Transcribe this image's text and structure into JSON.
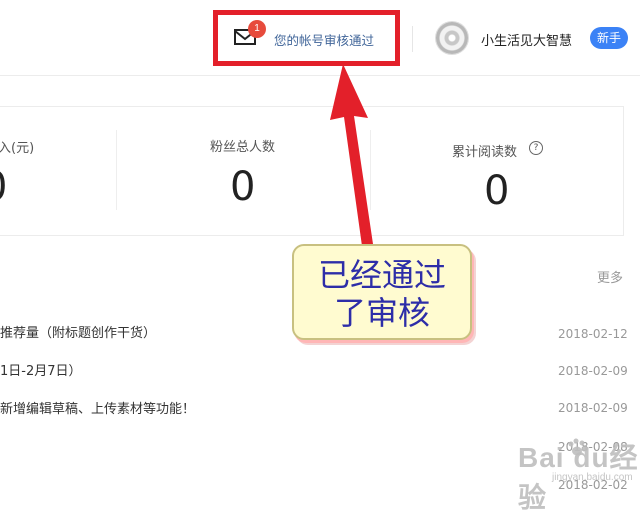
{
  "header": {
    "mail_icon": "envelope-icon",
    "unread_count": "1",
    "notice_text": "您的帐号审核通过",
    "username": "小生活见大智慧",
    "newbie_button": "新手"
  },
  "stats": [
    {
      "label": "入(元)",
      "value": "0"
    },
    {
      "label": "粉丝总人数",
      "value": "0"
    },
    {
      "label": "累计阅读数",
      "value": "0",
      "help_icon": "question-circle-icon"
    }
  ],
  "list": {
    "more_label": "更多",
    "items": [
      {
        "title": "推荐量（附标题创作干货）",
        "date": "2018-02-12"
      },
      {
        "title": "1日-2月7日）",
        "date": "2018-02-09"
      },
      {
        "title": "新增编辑草稿、上传素材等功能！",
        "date": "2018-02-09"
      },
      {
        "title": "",
        "date": "2018-02-08"
      },
      {
        "title": "",
        "date": "2018-02-02"
      }
    ]
  },
  "annotation": {
    "callout_text": "已经通过\n了审核",
    "colors": {
      "highlight_box": "#e3202a",
      "arrow": "#e3202a",
      "callout_bg": "#fffbd0",
      "callout_text": "#2d2da8"
    }
  },
  "watermark": {
    "text": "Bai du经验",
    "sub": "jingyan.baidu.com"
  }
}
